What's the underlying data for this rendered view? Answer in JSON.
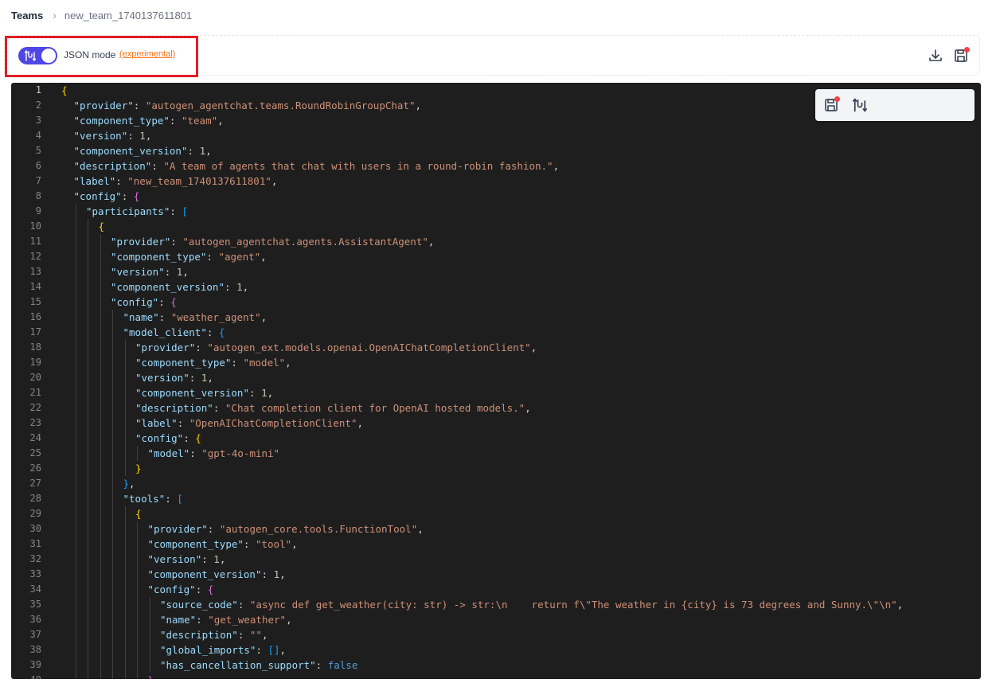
{
  "breadcrumb": {
    "root": "Teams",
    "separator": "›",
    "current": "new_team_1740137611801"
  },
  "toolbar": {
    "json_mode_label": "JSON mode",
    "experimental_label": "(experimental)",
    "toggle_on": true,
    "download_icon": "download-icon",
    "save_icon": "save-icon"
  },
  "colors": {
    "accent": "#4f46e5",
    "experimental": "#f97316",
    "highlight": "#e11d24",
    "editor_bg": "#1e1e1e",
    "unsaved_dot": "#ef4444"
  },
  "floating_panel": {
    "icons": [
      "save-icon",
      "json-toggle-icon"
    ]
  },
  "editor": {
    "lines": [
      [
        [
          "{",
          "br1"
        ]
      ],
      [
        [
          "\"provider\"",
          "k"
        ],
        [
          ": ",
          "p"
        ],
        [
          "\"autogen_agentchat.teams.RoundRobinGroupChat\"",
          "s"
        ],
        [
          ",",
          "p"
        ]
      ],
      [
        [
          "\"component_type\"",
          "k"
        ],
        [
          ": ",
          "p"
        ],
        [
          "\"team\"",
          "s"
        ],
        [
          ",",
          "p"
        ]
      ],
      [
        [
          "\"version\"",
          "k"
        ],
        [
          ": ",
          "p"
        ],
        [
          "1",
          "n"
        ],
        [
          ",",
          "p"
        ]
      ],
      [
        [
          "\"component_version\"",
          "k"
        ],
        [
          ": ",
          "p"
        ],
        [
          "1",
          "n"
        ],
        [
          ",",
          "p"
        ]
      ],
      [
        [
          "\"description\"",
          "k"
        ],
        [
          ": ",
          "p"
        ],
        [
          "\"A team of agents that chat with users in a round-robin fashion.\"",
          "s"
        ],
        [
          ",",
          "p"
        ]
      ],
      [
        [
          "\"label\"",
          "k"
        ],
        [
          ": ",
          "p"
        ],
        [
          "\"new_team_1740137611801\"",
          "s"
        ],
        [
          ",",
          "p"
        ]
      ],
      [
        [
          "\"config\"",
          "k"
        ],
        [
          ": ",
          "p"
        ],
        [
          "{",
          "br2"
        ]
      ],
      [
        [
          "\"participants\"",
          "k"
        ],
        [
          ": ",
          "p"
        ],
        [
          "[",
          "br3"
        ]
      ],
      [
        [
          "{",
          "br1"
        ]
      ],
      [
        [
          "\"provider\"",
          "k"
        ],
        [
          ": ",
          "p"
        ],
        [
          "\"autogen_agentchat.agents.AssistantAgent\"",
          "s"
        ],
        [
          ",",
          "p"
        ]
      ],
      [
        [
          "\"component_type\"",
          "k"
        ],
        [
          ": ",
          "p"
        ],
        [
          "\"agent\"",
          "s"
        ],
        [
          ",",
          "p"
        ]
      ],
      [
        [
          "\"version\"",
          "k"
        ],
        [
          ": ",
          "p"
        ],
        [
          "1",
          "n"
        ],
        [
          ",",
          "p"
        ]
      ],
      [
        [
          "\"component_version\"",
          "k"
        ],
        [
          ": ",
          "p"
        ],
        [
          "1",
          "n"
        ],
        [
          ",",
          "p"
        ]
      ],
      [
        [
          "\"config\"",
          "k"
        ],
        [
          ": ",
          "p"
        ],
        [
          "{",
          "br2"
        ]
      ],
      [
        [
          "\"name\"",
          "k"
        ],
        [
          ": ",
          "p"
        ],
        [
          "\"weather_agent\"",
          "s"
        ],
        [
          ",",
          "p"
        ]
      ],
      [
        [
          "\"model_client\"",
          "k"
        ],
        [
          ": ",
          "p"
        ],
        [
          "{",
          "br3"
        ]
      ],
      [
        [
          "\"provider\"",
          "k"
        ],
        [
          ": ",
          "p"
        ],
        [
          "\"autogen_ext.models.openai.OpenAIChatCompletionClient\"",
          "s"
        ],
        [
          ",",
          "p"
        ]
      ],
      [
        [
          "\"component_type\"",
          "k"
        ],
        [
          ": ",
          "p"
        ],
        [
          "\"model\"",
          "s"
        ],
        [
          ",",
          "p"
        ]
      ],
      [
        [
          "\"version\"",
          "k"
        ],
        [
          ": ",
          "p"
        ],
        [
          "1",
          "n"
        ],
        [
          ",",
          "p"
        ]
      ],
      [
        [
          "\"component_version\"",
          "k"
        ],
        [
          ": ",
          "p"
        ],
        [
          "1",
          "n"
        ],
        [
          ",",
          "p"
        ]
      ],
      [
        [
          "\"description\"",
          "k"
        ],
        [
          ": ",
          "p"
        ],
        [
          "\"Chat completion client for OpenAI hosted models.\"",
          "s"
        ],
        [
          ",",
          "p"
        ]
      ],
      [
        [
          "\"label\"",
          "k"
        ],
        [
          ": ",
          "p"
        ],
        [
          "\"OpenAIChatCompletionClient\"",
          "s"
        ],
        [
          ",",
          "p"
        ]
      ],
      [
        [
          "\"config\"",
          "k"
        ],
        [
          ": ",
          "p"
        ],
        [
          "{",
          "br1"
        ]
      ],
      [
        [
          "\"model\"",
          "k"
        ],
        [
          ": ",
          "p"
        ],
        [
          "\"gpt-4o-mini\"",
          "s"
        ]
      ],
      [
        [
          "}",
          "br1"
        ]
      ],
      [
        [
          "}",
          "br3"
        ],
        [
          ",",
          "p"
        ]
      ],
      [
        [
          "\"tools\"",
          "k"
        ],
        [
          ": ",
          "p"
        ],
        [
          "[",
          "br3"
        ]
      ],
      [
        [
          "{",
          "br1"
        ]
      ],
      [
        [
          "\"provider\"",
          "k"
        ],
        [
          ": ",
          "p"
        ],
        [
          "\"autogen_core.tools.FunctionTool\"",
          "s"
        ],
        [
          ",",
          "p"
        ]
      ],
      [
        [
          "\"component_type\"",
          "k"
        ],
        [
          ": ",
          "p"
        ],
        [
          "\"tool\"",
          "s"
        ],
        [
          ",",
          "p"
        ]
      ],
      [
        [
          "\"version\"",
          "k"
        ],
        [
          ": ",
          "p"
        ],
        [
          "1",
          "n"
        ],
        [
          ",",
          "p"
        ]
      ],
      [
        [
          "\"component_version\"",
          "k"
        ],
        [
          ": ",
          "p"
        ],
        [
          "1",
          "n"
        ],
        [
          ",",
          "p"
        ]
      ],
      [
        [
          "\"config\"",
          "k"
        ],
        [
          ": ",
          "p"
        ],
        [
          "{",
          "br2"
        ]
      ],
      [
        [
          "\"source_code\"",
          "k"
        ],
        [
          ": ",
          "p"
        ],
        [
          "\"async def get_weather(city: str) -> str:\\n    return f\\\"The weather in {city} is 73 degrees and Sunny.\\\"\\n\"",
          "s"
        ],
        [
          ",",
          "p"
        ]
      ],
      [
        [
          "\"name\"",
          "k"
        ],
        [
          ": ",
          "p"
        ],
        [
          "\"get_weather\"",
          "s"
        ],
        [
          ",",
          "p"
        ]
      ],
      [
        [
          "\"description\"",
          "k"
        ],
        [
          ": ",
          "p"
        ],
        [
          "\"\"",
          "s"
        ],
        [
          ",",
          "p"
        ]
      ],
      [
        [
          "\"global_imports\"",
          "k"
        ],
        [
          ": ",
          "p"
        ],
        [
          "[]",
          "br3"
        ],
        [
          ",",
          "p"
        ]
      ],
      [
        [
          "\"has_cancellation_support\"",
          "k"
        ],
        [
          ": ",
          "p"
        ],
        [
          "false",
          "b"
        ]
      ],
      [
        [
          "}",
          "br2"
        ]
      ]
    ]
  }
}
